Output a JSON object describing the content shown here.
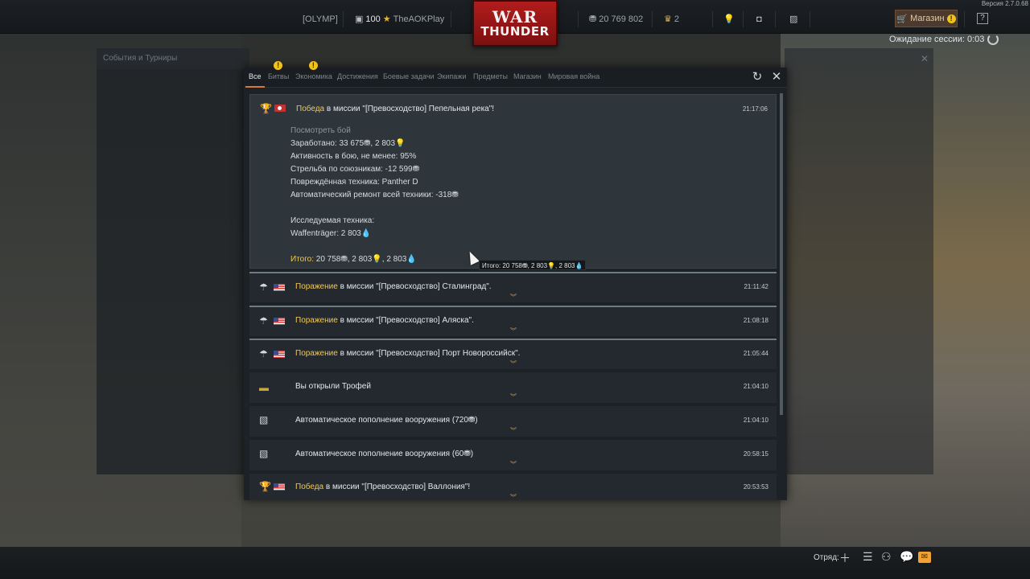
{
  "topbar": {
    "version": "Версия 2.7.0.68",
    "region": "[OLYMP]",
    "level": "100",
    "nickname": "TheAOKPlay",
    "silver_lions": "20 769 802",
    "eagles": "2",
    "logo_war": "WAR",
    "logo_thunder": "THUNDER",
    "shop_label": "Магазин",
    "help_label": "?"
  },
  "session": {
    "label": "Ожидание сессии: 0:03"
  },
  "background": {
    "left_panel_title": "События и Турниры"
  },
  "tabs": [
    {
      "label": "Все",
      "active": true,
      "badge": false
    },
    {
      "label": "Битвы",
      "badge": true
    },
    {
      "label": "Экономика",
      "badge": true
    },
    {
      "label": "Достижения",
      "badge": false
    },
    {
      "label": "Боевые задачи",
      "badge": false
    },
    {
      "label": "Экипажи",
      "badge": false
    },
    {
      "label": "Предметы",
      "badge": false
    },
    {
      "label": "Магазин",
      "badge": false
    },
    {
      "label": "Мировая война",
      "badge": false
    }
  ],
  "entries": [
    {
      "result": "Победа",
      "text": " в миссии \"[Превосходство] Пепельная река\"!",
      "time": "21:17:06",
      "details": {
        "view_battle": "Посмотреть бой",
        "earned": "Заработано: 33 675⛃, 2 803💡",
        "activity": "Активность в бою, не менее: 95%",
        "friendly_fire": "Стрельба по союзникам: -12 599⛃",
        "damaged": "Повреждённая техника: Panther D",
        "repair": "Автоматический ремонт всей техники: -318⛃",
        "research_title": "Исследуемая техника:",
        "research_item": "Waffenträger: 2 803💧",
        "total_label": "Итого:",
        "total_value": " 20 758⛃, 2 803💡, 2 803💧"
      }
    },
    {
      "result": "Поражение",
      "text": " в миссии \"[Превосходство] Сталинград\".",
      "time": "21:11:42"
    },
    {
      "result": "Поражение",
      "text": " в миссии \"[Превосходство] Аляска\".",
      "time": "21:08:18"
    },
    {
      "result": "Поражение",
      "text": " в миссии \"[Превосходство] Порт Новороссийск\".",
      "time": "21:05:44"
    },
    {
      "result": "",
      "text": "Вы открыли Трофей",
      "time": "21:04:10"
    },
    {
      "result": "",
      "text": "Автоматическое пополнение вооружения (720⛃)",
      "time": "21:04:10"
    },
    {
      "result": "",
      "text": "Автоматическое пополнение вооружения (60⛃)",
      "time": "20:58:15"
    },
    {
      "result": "Победа",
      "text": " в миссии \"[Превосходство] Валлония\"!",
      "time": "20:53:53"
    }
  ],
  "tooltip": "Итого: 20 758⛃, 2 803💡, 2 803💧",
  "bottombar": {
    "squad_label": "Отряд:"
  }
}
